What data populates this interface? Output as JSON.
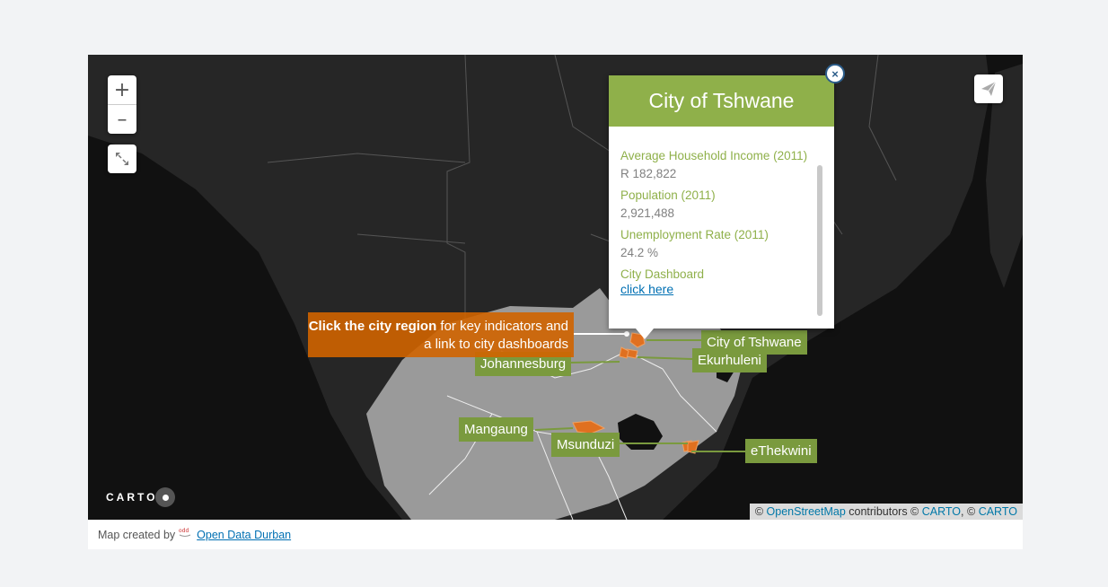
{
  "map": {
    "zoom_in_label": "+",
    "zoom_out_label": "–",
    "attribution": {
      "prefix": "© ",
      "osm_link": "OpenStreetMap",
      "middle": " contributors © ",
      "carto_link_1": "CARTO",
      "separator": ", © ",
      "carto_link_2": "CARTO"
    },
    "logo_text": "CARTO"
  },
  "callout": {
    "bold": "Click the city region",
    "rest_line1": " for key indicators and",
    "rest_line2": "a link to city dashboards"
  },
  "city_labels": [
    {
      "name": "City of Tshwane"
    },
    {
      "name": "Ekurhuleni"
    },
    {
      "name": "Johannesburg"
    },
    {
      "name": "Mangaung"
    },
    {
      "name": "Msunduzi"
    },
    {
      "name": "eThekwini"
    }
  ],
  "popup": {
    "title": "City of Tshwane",
    "close_label": "×",
    "fields": [
      {
        "label": "Average Household Income (2011)",
        "value": "R 182,822"
      },
      {
        "label": "Population (2011)",
        "value": "2,921,488"
      },
      {
        "label": "Unemployment Rate (2011)",
        "value": "24.2 %"
      }
    ],
    "dashboard_label": "City Dashboard",
    "dashboard_link": "click here"
  },
  "footer": {
    "made_by": "Map created by",
    "org_link": "Open Data Durban"
  },
  "colors": {
    "land_dark": "#1e1e1e",
    "sa_land": "#9a9a9a",
    "accent_green": "#8fb04a",
    "label_green": "#7a9a3e",
    "callout_orange": "#d06400",
    "region_orange": "#e07020"
  }
}
